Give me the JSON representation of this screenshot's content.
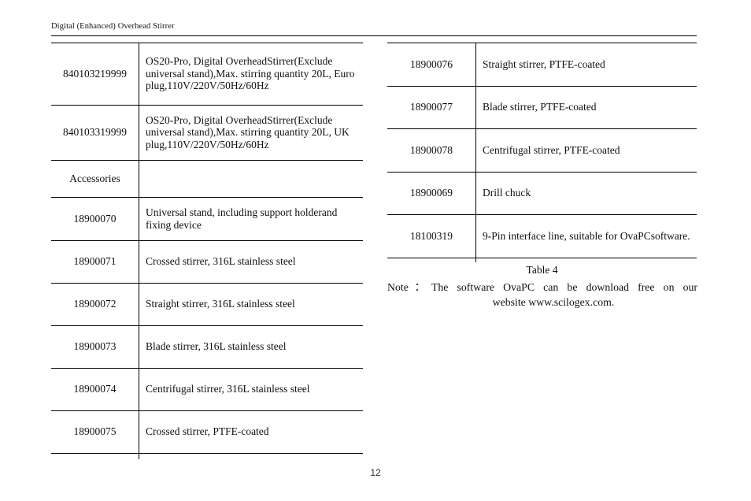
{
  "header": {
    "running_title": "Digital (Enhanced) Overhead Stirrer"
  },
  "left_table": {
    "rows": [
      {
        "code": "840103219999",
        "lines": [
          "OS20-Pro, Digital Overhead",
          "Stirrer(Exclude universal stand),",
          "Max. stirring quantity 20L, Euro plug,",
          "110V/220V/50Hz/60Hz"
        ]
      },
      {
        "code": "840103319999",
        "lines": [
          "OS20-Pro, Digital Overhead",
          "Stirrer(Exclude universal stand),",
          "Max. stirring quantity 20L, UK plug,",
          "110V/220V/50Hz/60Hz"
        ]
      },
      {
        "code": "Accessories",
        "lines": [
          ""
        ]
      },
      {
        "code": "18900070",
        "lines": [
          "Universal stand, including support holder",
          "and fixing device"
        ]
      },
      {
        "code": "18900071",
        "lines": [
          "Crossed stirrer, 316L stainless steel"
        ]
      },
      {
        "code": "18900072",
        "lines": [
          "Straight stirrer, 316L stainless steel"
        ]
      },
      {
        "code": "18900073",
        "lines": [
          "Blade stirrer, 316L stainless steel"
        ]
      },
      {
        "code": "18900074",
        "lines": [
          "Centrifugal stirrer, 316L stainless steel"
        ]
      },
      {
        "code": "18900075",
        "lines": [
          "Crossed stirrer, PTFE-coated"
        ]
      }
    ]
  },
  "right_table": {
    "rows": [
      {
        "code": "18900076",
        "lines": [
          "Straight stirrer, PTFE-coated"
        ]
      },
      {
        "code": "18900077",
        "lines": [
          "Blade stirrer, PTFE-coated"
        ]
      },
      {
        "code": "18900078",
        "lines": [
          "Centrifugal stirrer, PTFE-coated"
        ]
      },
      {
        "code": "18900069",
        "lines": [
          "Drill chuck"
        ]
      },
      {
        "code": "18100319",
        "lines": [
          "9-Pin interface line, suitable for OvaPC",
          "software."
        ]
      }
    ]
  },
  "caption": {
    "label": "Table 4"
  },
  "note": {
    "line1": "Note：The software OvaPC can be download free on our",
    "line2": "website www.scilogex.com."
  },
  "footer": {
    "page_number": "12"
  }
}
